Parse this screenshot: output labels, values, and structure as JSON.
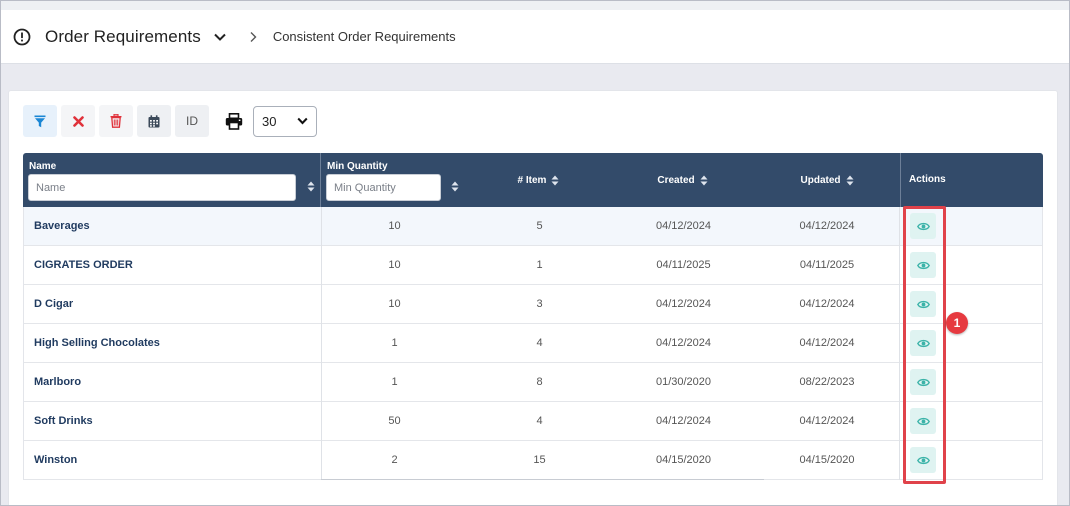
{
  "header": {
    "title": "Order Requirements",
    "breadcrumb_current": "Consistent Order Requirements"
  },
  "toolbar": {
    "id_label": "ID",
    "page_size": "30"
  },
  "table": {
    "columns": {
      "name": "Name",
      "min_quantity": "Min Quantity",
      "items": "# Item",
      "created": "Created",
      "updated": "Updated",
      "actions": "Actions"
    },
    "filters": {
      "name_placeholder": "Name",
      "min_quantity_placeholder": "Min Quantity"
    },
    "rows": [
      {
        "name": "Baverages",
        "min_quantity": "10",
        "items": "5",
        "created": "04/12/2024",
        "updated": "04/12/2024"
      },
      {
        "name": "CIGRATES ORDER",
        "min_quantity": "10",
        "items": "1",
        "created": "04/11/2025",
        "updated": "04/11/2025"
      },
      {
        "name": "D Cigar",
        "min_quantity": "10",
        "items": "3",
        "created": "04/12/2024",
        "updated": "04/12/2024"
      },
      {
        "name": "High Selling Chocolates",
        "min_quantity": "1",
        "items": "4",
        "created": "04/12/2024",
        "updated": "04/12/2024"
      },
      {
        "name": "Marlboro",
        "min_quantity": "1",
        "items": "8",
        "created": "01/30/2020",
        "updated": "08/22/2023"
      },
      {
        "name": "Soft Drinks",
        "min_quantity": "50",
        "items": "4",
        "created": "04/12/2024",
        "updated": "04/12/2024"
      },
      {
        "name": "Winston",
        "min_quantity": "2",
        "items": "15",
        "created": "04/15/2020",
        "updated": "04/15/2020"
      }
    ]
  },
  "annotation": {
    "callout_number": "1"
  },
  "colors": {
    "header_bg": "#334b6a",
    "accent_teal": "#3bb3a8",
    "danger_red": "#e0424a",
    "link_navy": "#1f3a5f"
  },
  "icons": {
    "header": "info-circle-icon",
    "title_dropdown": "chevron-down-icon",
    "breadcrumb_separator": "chevron-right-icon",
    "filter": "funnel-icon",
    "clear": "x-icon",
    "delete": "trash-icon",
    "calendar": "calendar-icon",
    "print": "printer-icon",
    "sort": "sort-icon",
    "view": "eye-icon"
  }
}
